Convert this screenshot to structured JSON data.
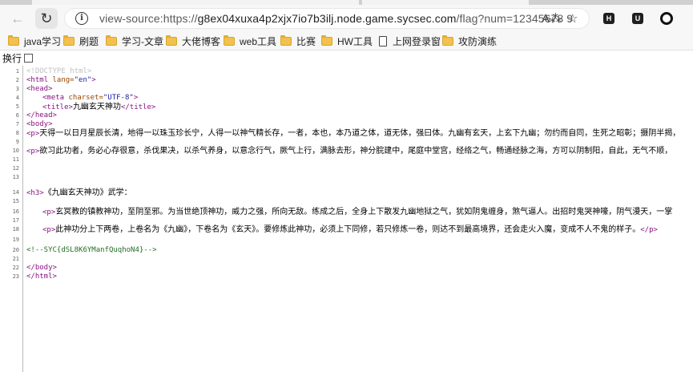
{
  "browser": {
    "url_prefix": "view-source:https://",
    "url_host": "g8ex04xuxa4p2xjx7io7b3ilj.node.game.sycsec.com",
    "url_path": "/flag?num=12345678 9",
    "icons": {
      "back": "arrow-left-icon",
      "forward": "arrow-right-icon",
      "refresh": "refresh-icon",
      "info": "info-icon",
      "read_aloud": "read-aloud-icon",
      "favorite": "star-icon"
    },
    "extensions": [
      "H",
      "U"
    ]
  },
  "bookmarks": [
    {
      "label": "java学习",
      "icon": "folder-icon"
    },
    {
      "label": "刷题",
      "icon": "folder-icon"
    },
    {
      "label": "学习-文章",
      "icon": "folder-icon"
    },
    {
      "label": "大佬博客",
      "icon": "folder-icon"
    },
    {
      "label": "web工具",
      "icon": "folder-icon"
    },
    {
      "label": "比赛",
      "icon": "folder-icon"
    },
    {
      "label": "HW工具",
      "icon": "folder-icon"
    },
    {
      "label": "上网登录窗",
      "icon": "page-icon"
    },
    {
      "label": "攻防演练",
      "icon": "folder-icon"
    }
  ],
  "wrap_label": "换行",
  "source": {
    "line_numbers": [
      "1",
      "2",
      "3",
      "4",
      "5",
      "6",
      "7",
      "8",
      "9",
      "10",
      "11",
      "12",
      "13",
      "14",
      "15",
      "16",
      "17",
      "18",
      "19",
      "20",
      "21",
      "22",
      "23"
    ],
    "doctype": "<!DOCTYPE html>",
    "html_open": "<html",
    "lang_attr": " lang=",
    "lang_val": "\"en\"",
    "gt": ">",
    "head_open": "<head>",
    "meta_open": "<meta",
    "charset_attr": " charset=",
    "charset_val": "\"UTF-8\"",
    "title_open": "<title>",
    "title_text": "九幽玄天神功",
    "title_close": "</title>",
    "head_close": "</head>",
    "body_open": "<body>",
    "p_open": "<p>",
    "p_close": "</p>",
    "line8_text": "天得一以日月星辰长清，地得一以珠玉珍长宁，人得一以神气精长存，一者，本也，本乃道之体，道无体，强曰体。九幽有玄天，上玄下九幽；勿约而自同，生死之昭彰；摄阴半揭，",
    "line9_text": "欲习此功者，务必心存很意，杀伐果决，以杀气养身，以意念行气，厥气上行，满脉去形，神分脘建中，尾庭中堂宫，经络之气，畅通经脉之海，方可以阴制阳，自此，无气不顺，",
    "h3_open": "<h3>",
    "h3_text": "《九幽玄天神功》武学：",
    "line16_text": "玄冥教的镇教神功，至阴至邪。为当世绝顶神功，威力之强，所向无敌。练成之后，全身上下散发九幽地狱之气，犹如阴鬼缠身，煞气逼人。出招时鬼哭神嚎，阴气漫天，一掌",
    "line18_text": "此神功分上下两卷，上卷名为《九幽》，下卷名为《玄天》。要修炼此神功，必须上下同修，若只修炼一卷，则达不到最高境界，还会走火入魔，变成不人不鬼的样子。",
    "comment": "<!--SYC{dSL8K6YManfQuqhoN4}-->",
    "body_close": "</body>",
    "html_close": "</html>"
  }
}
